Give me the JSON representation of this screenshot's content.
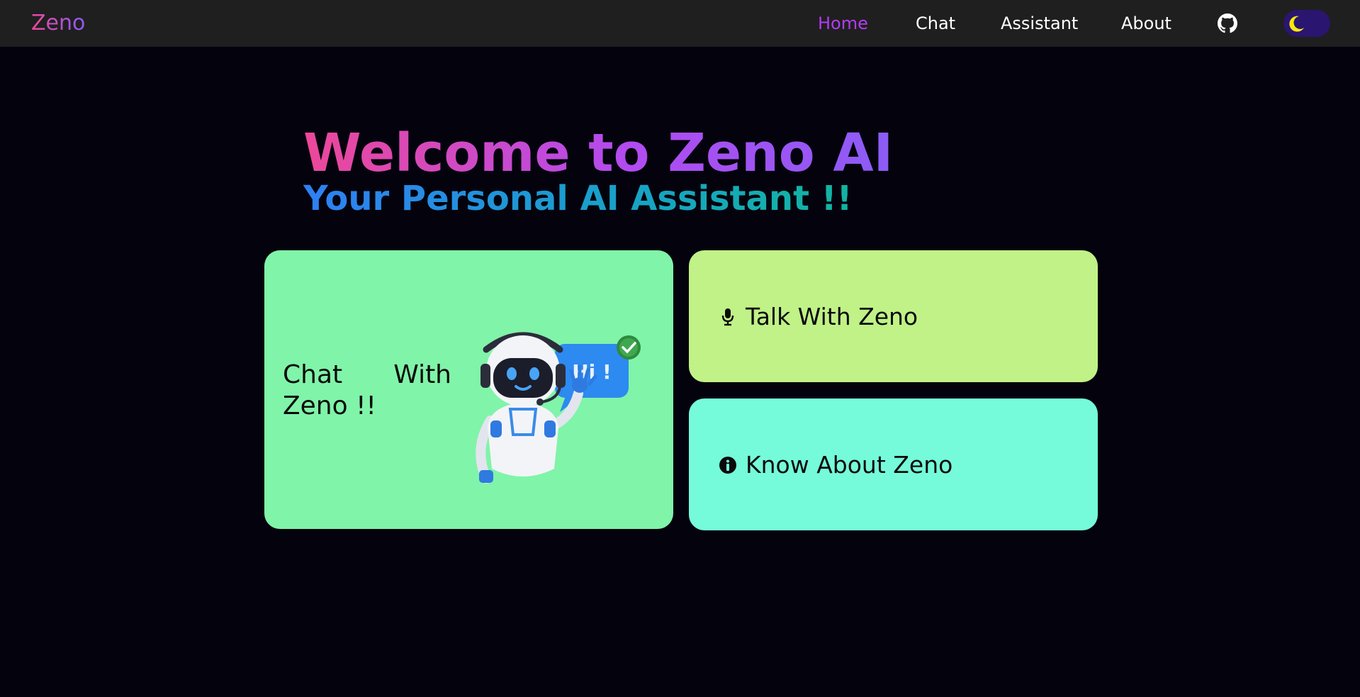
{
  "nav": {
    "brand": "Zeno",
    "links": [
      {
        "label": "Home",
        "active": true
      },
      {
        "label": "Chat",
        "active": false
      },
      {
        "label": "Assistant",
        "active": false
      },
      {
        "label": "About",
        "active": false
      }
    ],
    "github_icon": "github-icon",
    "theme_toggle_icon": "moon-icon",
    "accent_color": "#b23cf0"
  },
  "hero": {
    "title": "Welcome to Zeno AI",
    "subtitle": "Your Personal AI Assistant !!"
  },
  "cards": {
    "chat": {
      "label": "Chat With Zeno !!",
      "image_bubble_text": "Hi !",
      "color": "#80f4a9"
    },
    "talk": {
      "label": "Talk With Zeno",
      "icon": "microphone-icon",
      "color": "#c0f287"
    },
    "about": {
      "label": "Know About Zeno",
      "icon": "info-icon",
      "color": "#75fbda"
    }
  }
}
